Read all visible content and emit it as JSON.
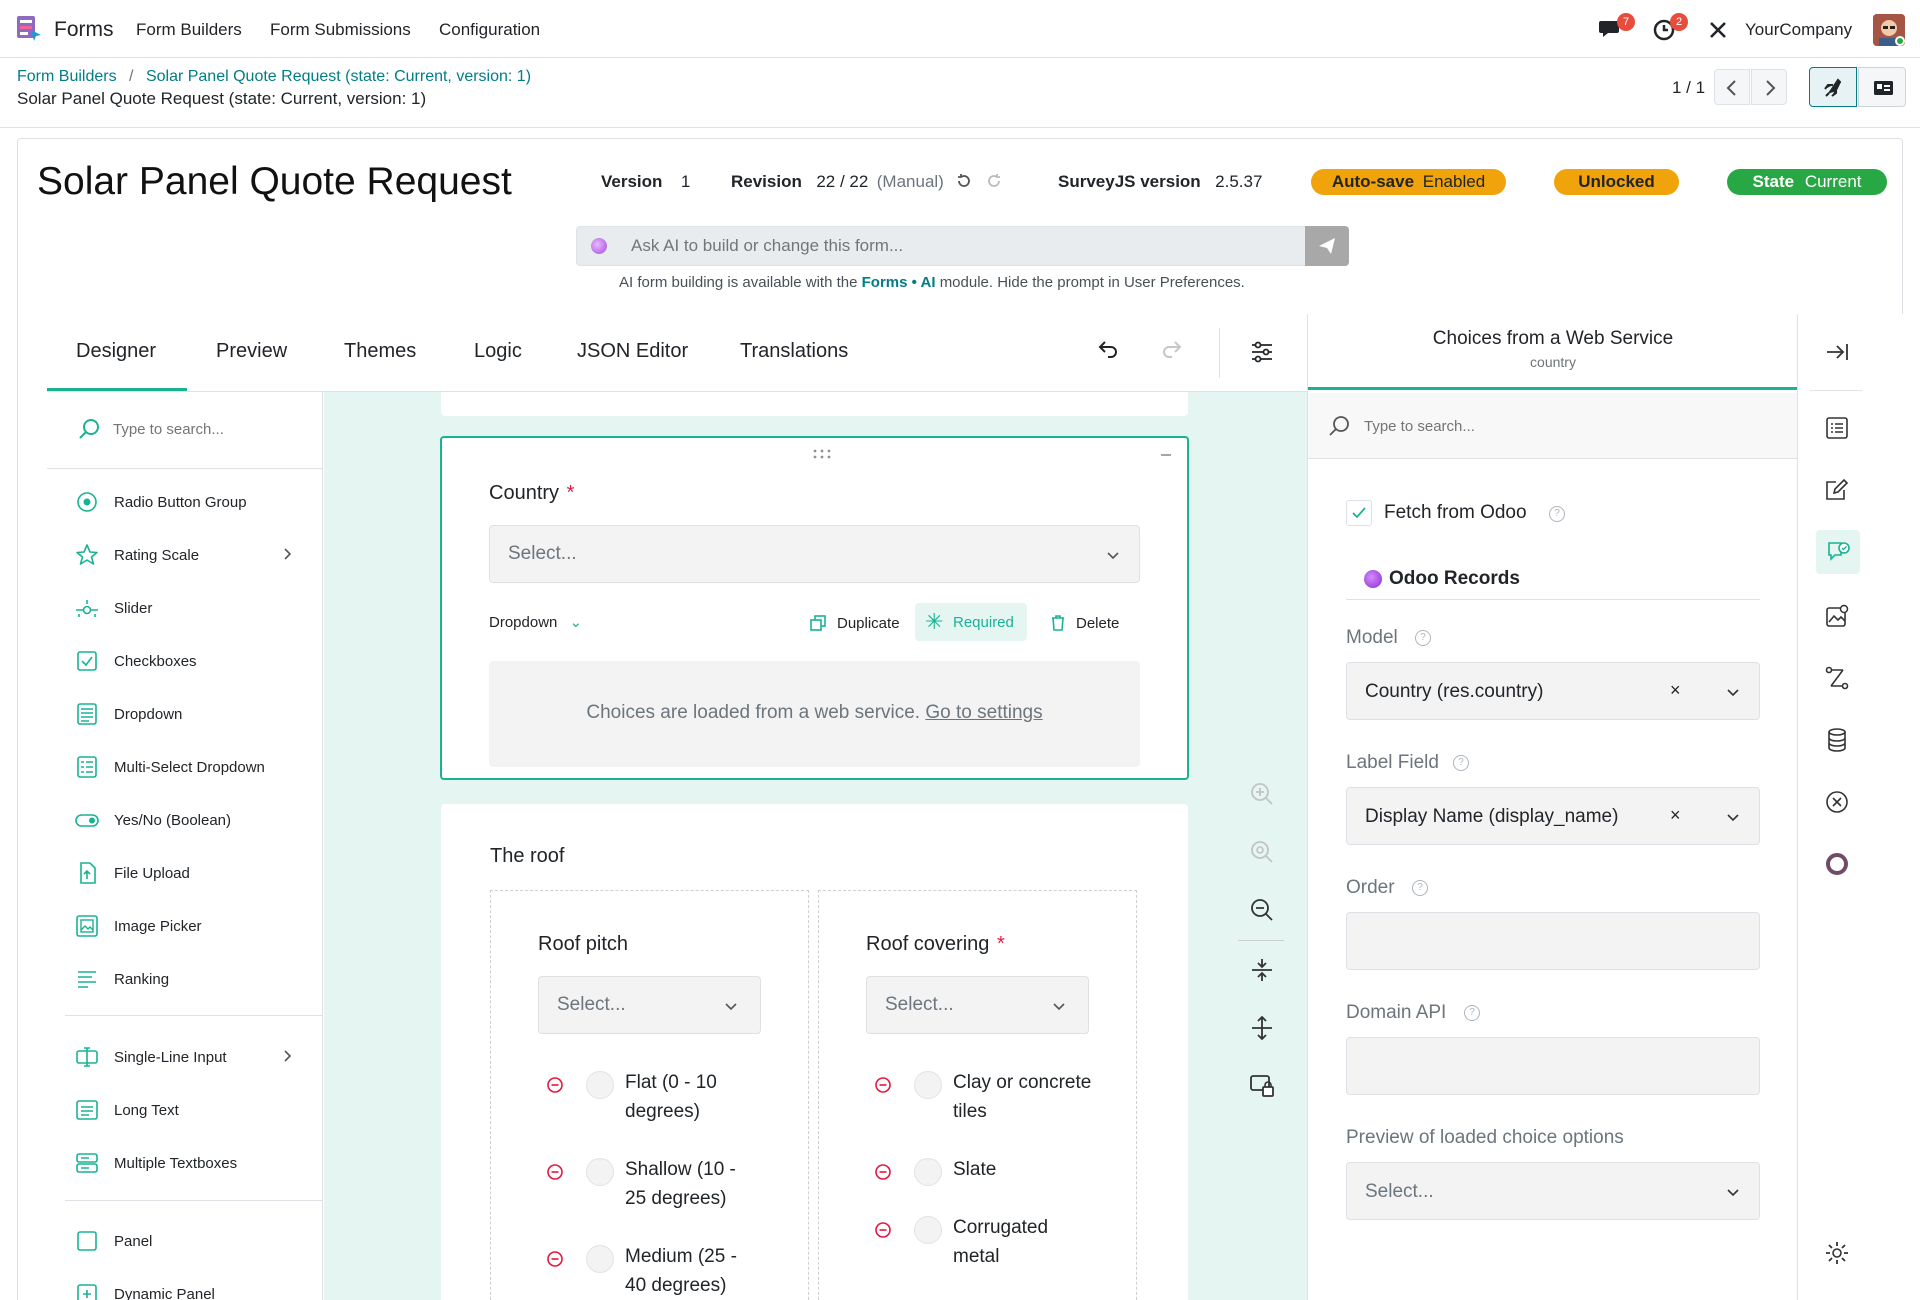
{
  "topbar": {
    "app_name": "Forms",
    "menu": [
      "Form Builders",
      "Form Submissions",
      "Configuration"
    ],
    "messages_count": "7",
    "activities_count": "2",
    "company": "YourCompany"
  },
  "control_panel": {
    "breadcrumb_parent": "Form Builders",
    "breadcrumb_separator": "/",
    "breadcrumb_current": "Solar Panel Quote Request (state: Current, version: 1)",
    "record_title": "Solar Panel Quote Request (state: Current, version: 1)",
    "pager": "1 / 1"
  },
  "header": {
    "form_title": "Solar Panel Quote Request",
    "version_label": "Version",
    "version_value": "1",
    "revision_label": "Revision",
    "revision_value": "22 / 22",
    "revision_mode": "(Manual)",
    "surveyjs_label": "SurveyJS version",
    "surveyjs_value": "2.5.37",
    "autosave_label": "Auto-save",
    "autosave_value": "Enabled",
    "lock_label": "Unlocked",
    "state_label": "State",
    "state_value": "Current",
    "autosave_color": "#f0a30a",
    "state_color": "#28a745"
  },
  "ai_prompt": {
    "placeholder": "Ask AI to build or change this form...",
    "hint_prefix": "AI form building is available with the",
    "hint_module": "Forms • AI",
    "hint_suffix": "module. Hide the prompt in User Preferences."
  },
  "tabs": [
    "Designer",
    "Preview",
    "Themes",
    "Logic",
    "JSON Editor",
    "Translations"
  ],
  "toolbox": {
    "search_placeholder": "Type to search...",
    "items": [
      {
        "label": "Radio Button Group",
        "icon": "radio-icon"
      },
      {
        "label": "Rating Scale",
        "icon": "star-icon"
      },
      {
        "label": "Slider",
        "icon": "slider-icon"
      },
      {
        "label": "Checkboxes",
        "icon": "checkbox-icon"
      },
      {
        "label": "Dropdown",
        "icon": "dropdown-icon"
      },
      {
        "label": "Multi-Select Dropdown",
        "icon": "multiselect-icon"
      },
      {
        "label": "Yes/No (Boolean)",
        "icon": "toggle-icon"
      },
      {
        "label": "File Upload",
        "icon": "upload-icon"
      },
      {
        "label": "Image Picker",
        "icon": "image-icon"
      },
      {
        "label": "Ranking",
        "icon": "ranking-icon"
      },
      {
        "label": "Single-Line Input",
        "icon": "text-input-icon"
      },
      {
        "label": "Long Text",
        "icon": "long-text-icon"
      },
      {
        "label": "Multiple Textboxes",
        "icon": "multi-text-icon"
      },
      {
        "label": "Panel",
        "icon": "panel-icon"
      },
      {
        "label": "Dynamic Panel",
        "icon": "dynamic-panel-icon"
      }
    ]
  },
  "question_country": {
    "title": "Country",
    "required_mark": "*",
    "select_placeholder": "Select...",
    "type_label": "Dropdown",
    "duplicate_label": "Duplicate",
    "required_label": "Required",
    "delete_label": "Delete",
    "info_text": "Choices are loaded from a web service.",
    "info_link": "Go to settings"
  },
  "panel_roof": {
    "title": "The roof",
    "pitch": {
      "title": "Roof pitch",
      "placeholder": "Select...",
      "options": [
        "Flat (0 - 10 degrees)",
        "Shallow (10 - 25 degrees)",
        "Medium (25 - 40 degrees)"
      ]
    },
    "covering": {
      "title": "Roof covering",
      "required_mark": "*",
      "placeholder": "Select...",
      "options": [
        "Clay or concrete tiles",
        "Slate",
        "Corrugated metal"
      ]
    }
  },
  "property_panel": {
    "title": "Choices from a Web Service",
    "subtitle": "country",
    "search_placeholder": "Type to search...",
    "fetch_label": "Fetch from Odoo",
    "section_title": "Odoo Records",
    "model_label": "Model",
    "model_value": "Country (res.country)",
    "label_field_label": "Label Field",
    "label_field_value": "Display Name (display_name)",
    "order_label": "Order",
    "domain_label": "Domain API",
    "preview_label": "Preview of loaded choice options",
    "preview_placeholder": "Select..."
  },
  "colors": {
    "accent": "#19b394",
    "odoo_teal": "#017e84",
    "required_red": "#e5173f"
  }
}
